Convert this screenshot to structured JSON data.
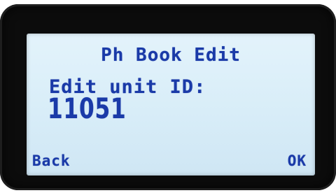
{
  "screen": {
    "title": "Ph Book Edit",
    "prompt": "Edit unit ID:",
    "value": "11051"
  },
  "softkeys": {
    "left": "Back",
    "right": "OK"
  },
  "colors": {
    "lcd_background": "#dbeef9",
    "lcd_text": "#1a3aa8",
    "bezel": "#0c0c0c"
  }
}
